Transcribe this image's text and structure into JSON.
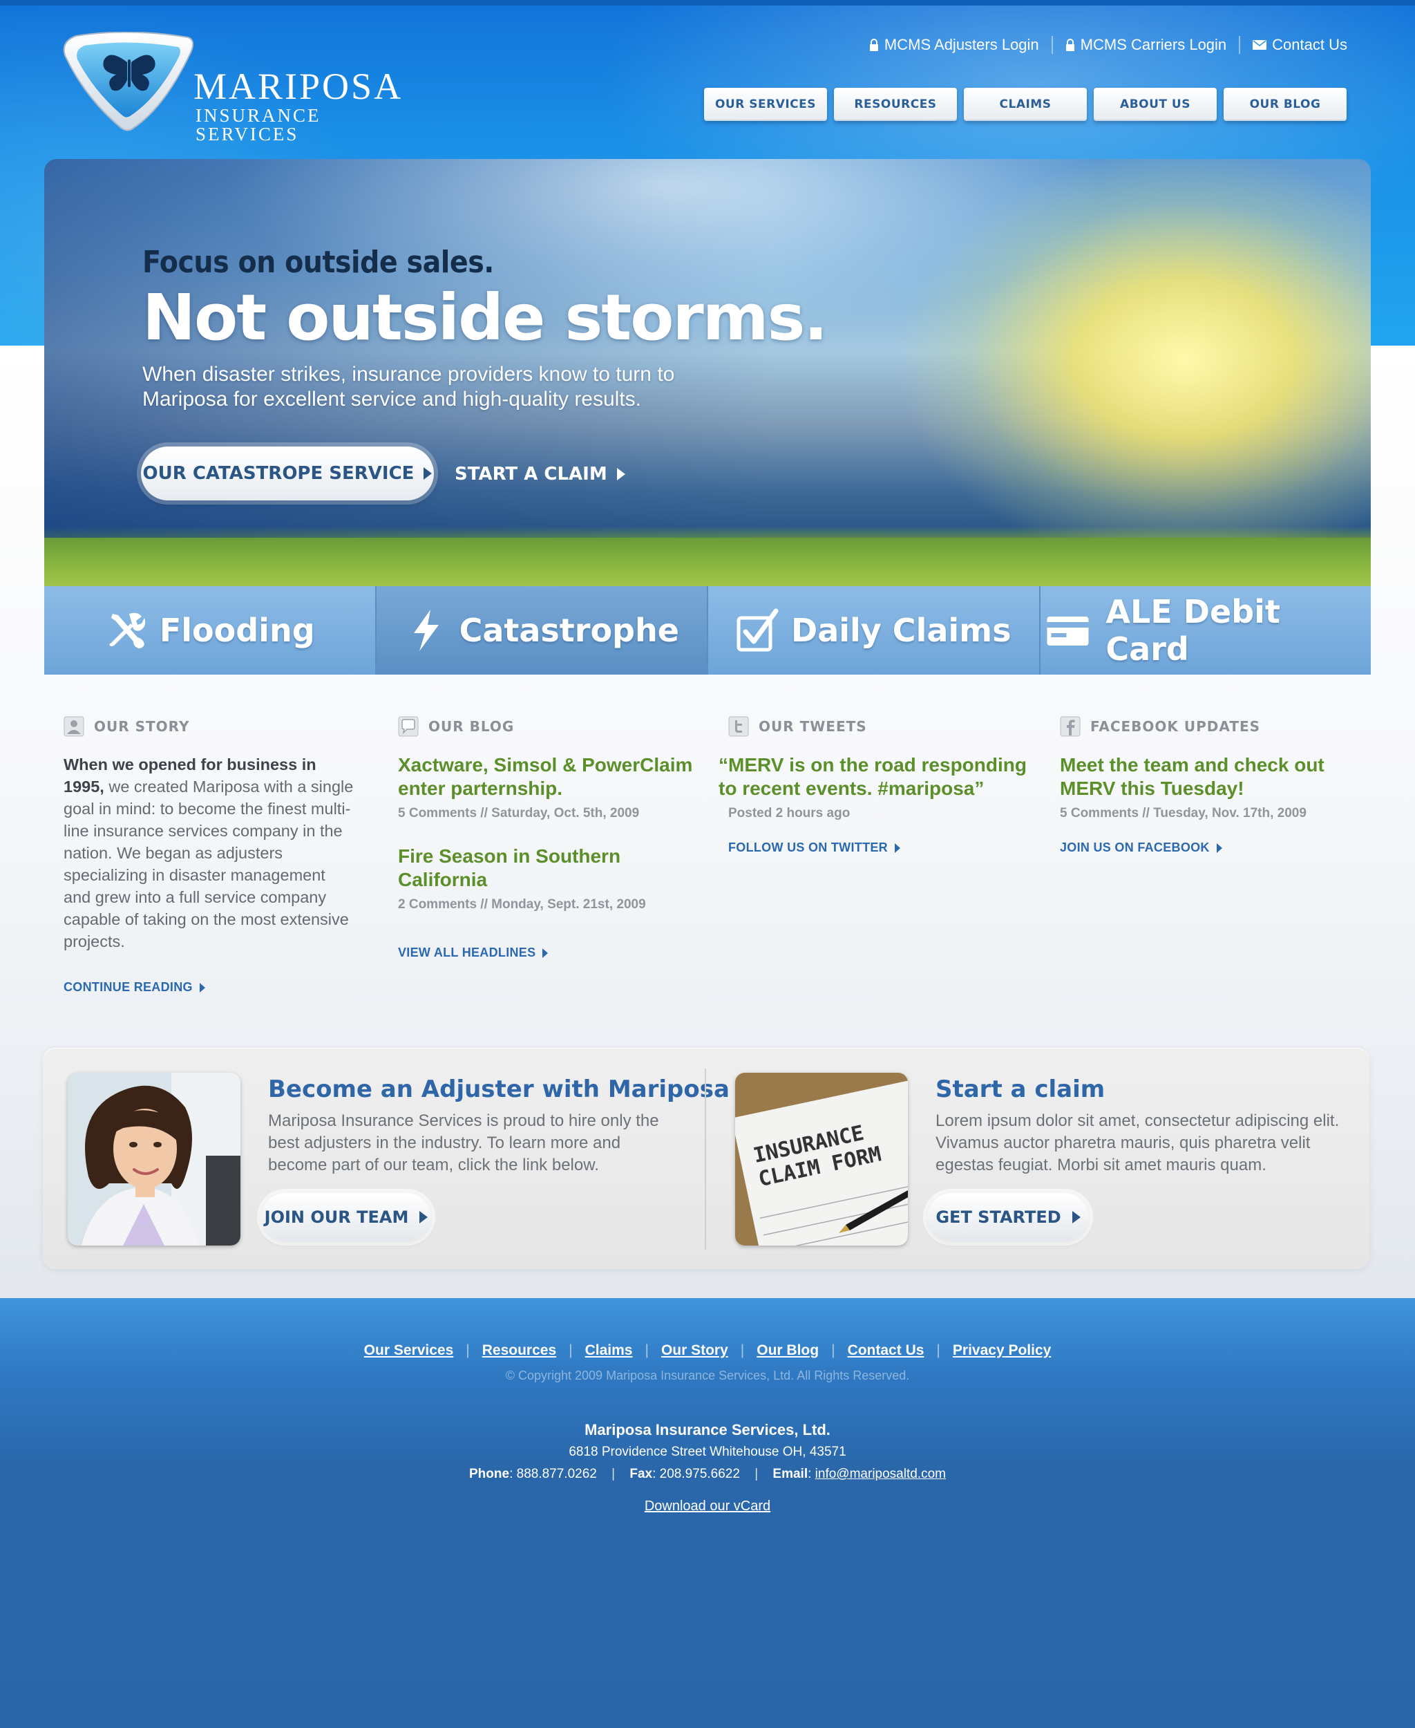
{
  "brand": {
    "name": "MARIPOSA",
    "subtitle": "INSURANCE SERVICES"
  },
  "top_links": [
    {
      "label": "MCMS Adjusters Login",
      "icon": "lock-icon"
    },
    {
      "label": "MCMS Carriers Login",
      "icon": "lock-icon"
    },
    {
      "label": "Contact Us",
      "icon": "mail-icon"
    }
  ],
  "nav": [
    "OUR SERVICES",
    "RESOURCES",
    "CLAIMS",
    "ABOUT US",
    "OUR BLOG"
  ],
  "hero": {
    "eyebrow": "Focus on outside sales.",
    "title": "Not outside storms.",
    "description": "When disaster strikes, insurance providers know to turn to Mariposa for excellent service and high-quality results.",
    "cta_primary": "OUR CATASTROPE SERVICE",
    "cta_secondary": "START A CLAIM"
  },
  "tabs": [
    {
      "label": "Flooding",
      "icon": "tools-icon"
    },
    {
      "label": "Catastrophe",
      "icon": "lightning-icon",
      "active": true
    },
    {
      "label": "Daily Claims",
      "icon": "checkbox-icon"
    },
    {
      "label": "ALE Debit Card",
      "icon": "credit-card-icon"
    }
  ],
  "story": {
    "title": "OUR STORY",
    "lead": "When we opened for business in 1995,",
    "text": " we created Mariposa with a single goal in mind: to become the finest multi-line insurance services company in the nation. We began as adjusters specializing in disaster management and grew into a full service company capable of taking on the most extensive projects.",
    "link": "CONTINUE READING"
  },
  "blog": {
    "title": "OUR BLOG",
    "posts": [
      {
        "title": "Xactware, Simsol & PowerClaim enter parternship.",
        "meta": "5 Comments  //  Saturday, Oct. 5th, 2009"
      },
      {
        "title": "Fire Season in Southern California",
        "meta": "2 Comments  //  Monday, Sept. 21st, 2009"
      }
    ],
    "link": "VIEW ALL HEADLINES"
  },
  "tweets": {
    "title": "OUR TWEETS",
    "tweet": "“MERV is on the road responding to recent events. #mariposa”",
    "meta": "Posted 2 hours ago",
    "link": "FOLLOW US ON TWITTER"
  },
  "facebook": {
    "title": "FACEBOOK UPDATES",
    "post": "Meet the team and check out MERV this Tuesday!",
    "meta": "5 Comments  //  Tuesday, Nov. 17th, 2009",
    "link": "JOIN US ON FACEBOOK"
  },
  "promo": {
    "adjuster": {
      "title": "Become an Adjuster with Mariposa",
      "text": "Mariposa Insurance Services is proud to hire only the best adjusters in the industry. To learn more and become part of our team, click the link below.",
      "button": "JOIN OUR TEAM"
    },
    "claim": {
      "title": "Start a claim",
      "text": "Lorem ipsum dolor sit amet, consectetur adipiscing elit. Vivamus auctor pharetra mauris, quis pharetra velit egestas feugiat. Morbi sit amet mauris quam.",
      "button": "GET STARTED",
      "photo_text_1": "INSURANCE",
      "photo_text_2": "CLAIM FORM"
    }
  },
  "footer": {
    "links": [
      "Our Services",
      "Resources",
      "Claims",
      "Our Story",
      "Our Blog",
      "Contact Us",
      "Privacy Policy"
    ],
    "copyright": "© Copyright 2009 Mariposa Insurance Services, Ltd. All Rights Reserved.",
    "company": "Mariposa Insurance Services, Ltd.",
    "address": "6818 Providence Street Whitehouse OH, 43571",
    "phone_label": "Phone",
    "phone": "888.877.0262",
    "fax_label": "Fax",
    "fax": "208.975.6622",
    "email_label": "Email",
    "email": "info@mariposaltd.com",
    "vcard": "Download our vCard"
  },
  "colors": {
    "brand_blue": "#2a65a8",
    "accent_green": "#5b8f2a",
    "link_blue": "#2a68b0"
  }
}
